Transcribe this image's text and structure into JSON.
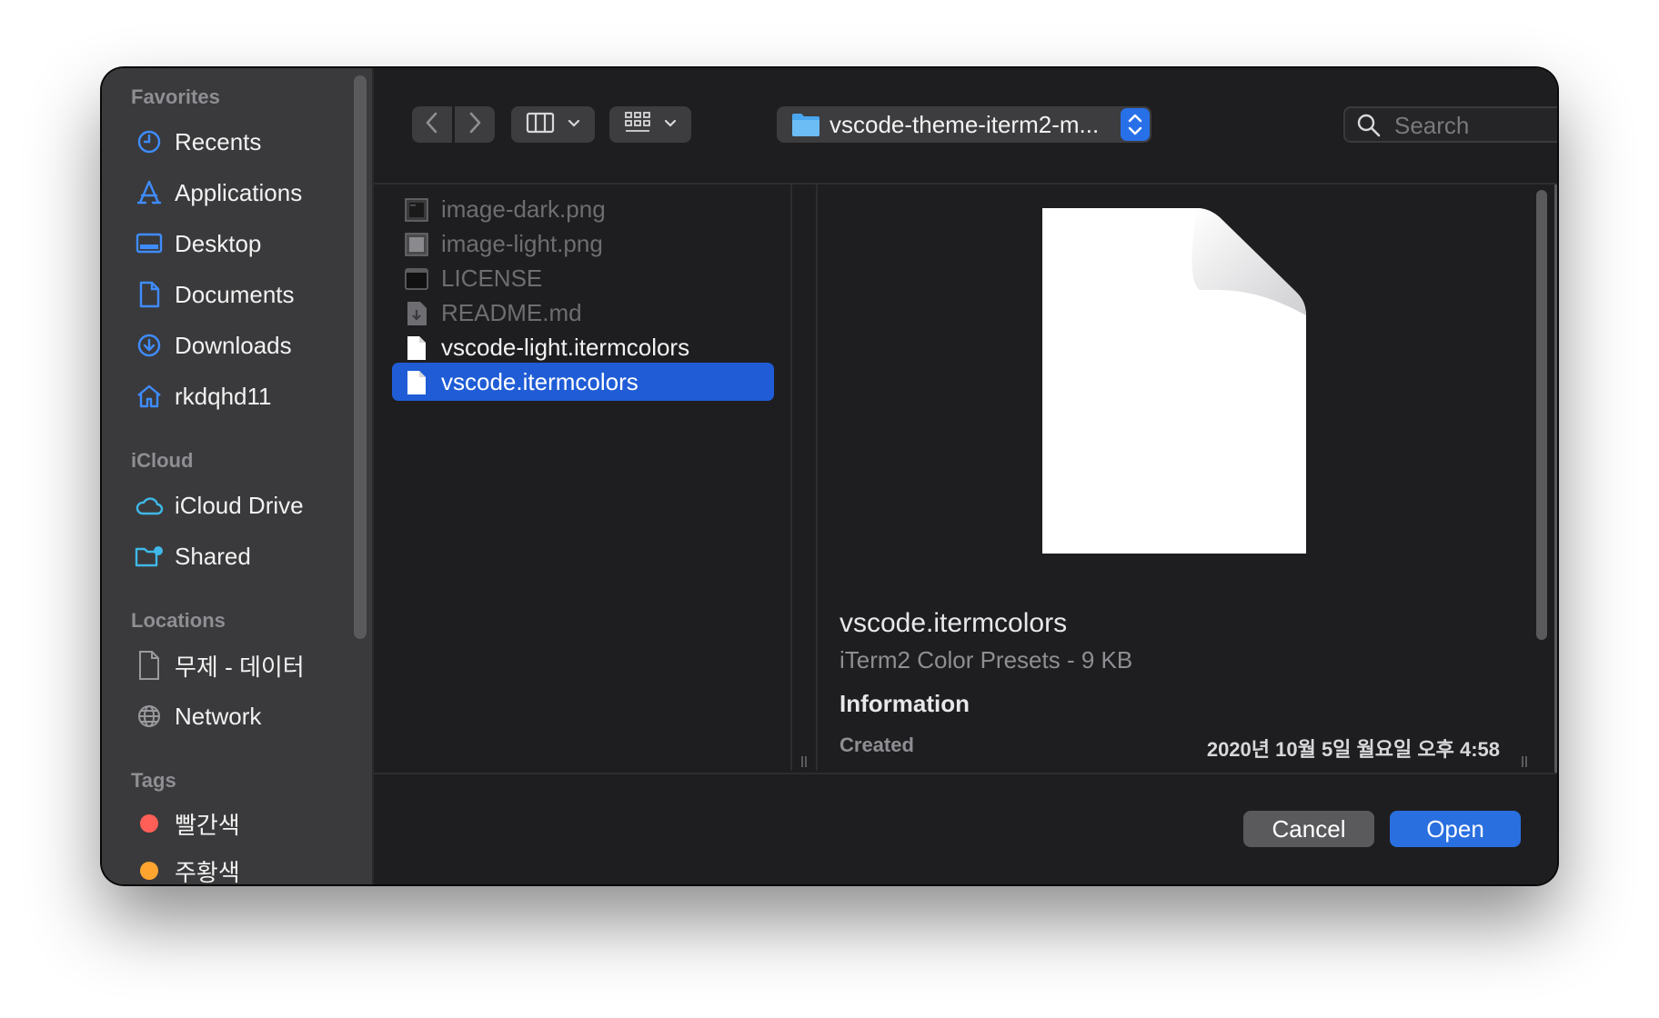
{
  "sidebar": {
    "favorites_heading": "Favorites",
    "favorites": [
      {
        "label": "Recents",
        "icon": "clock-icon"
      },
      {
        "label": "Applications",
        "icon": "applications-icon"
      },
      {
        "label": "Desktop",
        "icon": "desktop-icon"
      },
      {
        "label": "Documents",
        "icon": "document-icon"
      },
      {
        "label": "Downloads",
        "icon": "download-icon"
      },
      {
        "label": "rkdqhd11",
        "icon": "home-icon"
      }
    ],
    "icloud_heading": "iCloud",
    "icloud": [
      {
        "label": "iCloud Drive",
        "icon": "cloud-icon"
      },
      {
        "label": "Shared",
        "icon": "shared-folder-icon"
      }
    ],
    "locations_heading": "Locations",
    "locations": [
      {
        "label": "무제 - 데이터",
        "icon": "disk-icon"
      },
      {
        "label": "Network",
        "icon": "globe-icon"
      }
    ],
    "tags_heading": "Tags",
    "tags": [
      {
        "label": "빨간색",
        "color": "#ff5f57"
      },
      {
        "label": "주황색",
        "color": "#ffa52f"
      }
    ]
  },
  "toolbar": {
    "back_icon": "chevron-left-icon",
    "forward_icon": "chevron-right-icon",
    "view_icon": "columns-icon",
    "group_icon": "grid-icon",
    "path_label": "vscode-theme-iterm2-m...",
    "search_placeholder": "Search"
  },
  "files": [
    {
      "name": "image-dark.png",
      "enabled": false,
      "selected": false,
      "icon": "image-file-icon"
    },
    {
      "name": "image-light.png",
      "enabled": false,
      "selected": false,
      "icon": "image-file-icon"
    },
    {
      "name": "LICENSE",
      "enabled": false,
      "selected": false,
      "icon": "terminal-file-icon"
    },
    {
      "name": "README.md",
      "enabled": false,
      "selected": false,
      "icon": "markdown-file-icon"
    },
    {
      "name": "vscode-light.itermcolors",
      "enabled": true,
      "selected": false,
      "icon": "blank-file-icon"
    },
    {
      "name": "vscode.itermcolors",
      "enabled": true,
      "selected": true,
      "icon": "blank-file-icon"
    }
  ],
  "preview": {
    "file_name": "vscode.itermcolors",
    "kind": "iTerm2 Color Presets - 9 KB",
    "info_heading": "Information",
    "created_label": "Created",
    "created_value": "2020년 10월 5일 월요일 오후 4:58"
  },
  "buttons": {
    "cancel": "Cancel",
    "open": "Open"
  },
  "colors": {
    "accent": "#1f5cd6",
    "open_button": "#2a6fe0",
    "sidebar_icon": "#3f8cff"
  }
}
